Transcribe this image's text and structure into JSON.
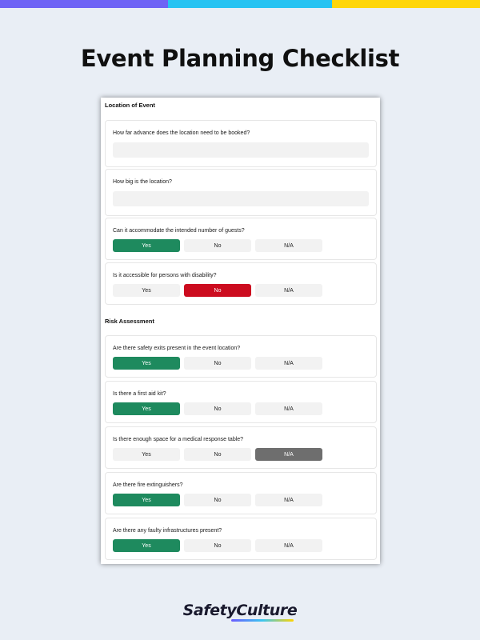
{
  "page": {
    "title": "Event Planning Checklist"
  },
  "colors": {
    "bar_purple": "#6e63f5",
    "bar_cyan": "#27c3f2",
    "bar_yellow": "#ffd60a",
    "yes_selected": "#1e8a5e",
    "no_selected": "#cc0c1f",
    "na_selected": "#6e6e6e"
  },
  "option_labels": {
    "yes": "Yes",
    "no": "No",
    "na": "N/A"
  },
  "sections": [
    {
      "title": "Location of Event",
      "items": [
        {
          "question": "How far advance does the location need to be booked?",
          "type": "text"
        },
        {
          "question": "How big is the location?",
          "type": "text"
        },
        {
          "question": "Can it accommodate the intended number of guests?",
          "type": "choice",
          "selected": "yes"
        },
        {
          "question": "Is it accessible for persons with disability?",
          "type": "choice",
          "selected": "no"
        }
      ]
    },
    {
      "title": "Risk Assessment",
      "items": [
        {
          "question": "Are there safety exits present in the event location?",
          "type": "choice",
          "selected": "yes"
        },
        {
          "question": "Is there a first aid kit?",
          "type": "choice",
          "selected": "yes"
        },
        {
          "question": "Is there enough space for a medical response table?",
          "type": "choice",
          "selected": "na"
        },
        {
          "question": "Are there fire extinguishers?",
          "type": "choice",
          "selected": "yes"
        },
        {
          "question": "Are there any faulty infrastructures present?",
          "type": "choice",
          "selected": "yes"
        }
      ]
    }
  ],
  "footer": {
    "logo_text": "SafetyCulture"
  }
}
